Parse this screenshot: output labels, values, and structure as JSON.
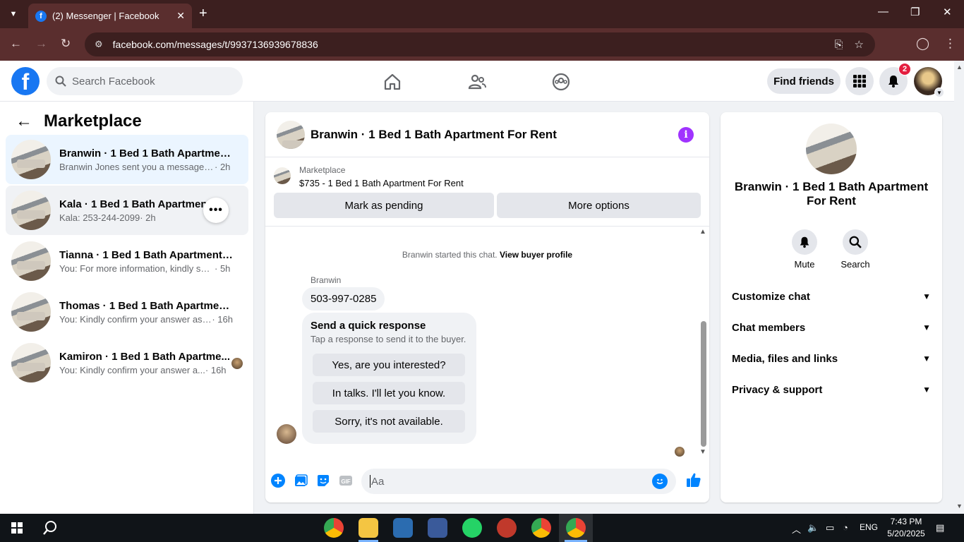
{
  "browser": {
    "tab_title": "(2) Messenger | Facebook",
    "tab_favicon": "f",
    "url": "facebook.com/messages/t/9937136939678836"
  },
  "fb": {
    "search_placeholder": "Search Facebook",
    "find_friends": "Find friends",
    "notif_count": "2"
  },
  "left": {
    "title": "Marketplace",
    "conversations": [
      {
        "name": "Branwin · 1 Bed 1 Bath Apartment ...",
        "snippet": "Branwin Jones sent you a message ab...",
        "time": "· 2h"
      },
      {
        "name": "Kala · 1 Bed 1 Bath Apartment F...",
        "snippet": "Kala: 253-244-2099",
        "time": "· 2h"
      },
      {
        "name": "Tianna · 1 Bed 1 Bath Apartment F...",
        "snippet": "You: For more information, kindly shar...",
        "time": "· 5h"
      },
      {
        "name": "Thomas · 1 Bed 1 Bath Apartment ...",
        "snippet": "You: Kindly confirm your answer as s...",
        "time": "· 16h"
      },
      {
        "name": "Kamiron · 1 Bed 1 Bath Apartme...",
        "snippet": "You: Kindly confirm your answer a...",
        "time": "· 16h"
      }
    ]
  },
  "chat": {
    "title": "Branwin · 1 Bed 1 Bath Apartment For Rent",
    "listing_source": "Marketplace",
    "listing_price": "$735 - 1 Bed 1 Bath Apartment For Rent",
    "mark_pending": "Mark as pending",
    "more_options": "More options",
    "system_note": "Branwin started this chat.",
    "view_buyer": "View buyer profile",
    "sender": "Branwin",
    "message": "503-997-0285",
    "quick_title": "Send a quick response",
    "quick_sub": "Tap a response to send it to the buyer.",
    "quick_replies": [
      "Yes, are you interested?",
      "In talks. I'll let you know.",
      "Sorry, it's not available."
    ],
    "input_placeholder": "Aa"
  },
  "right": {
    "name": "Branwin · 1 Bed 1 Bath Apartment For Rent",
    "mute": "Mute",
    "search": "Search",
    "sections": [
      "Customize chat",
      "Chat members",
      "Media, files and links",
      "Privacy & support"
    ]
  },
  "taskbar": {
    "lang": "ENG",
    "time": "7:43 PM",
    "date": "5/20/2025"
  },
  "colors": {
    "fb_blue": "#1877f2",
    "messenger_blue": "#0084ff",
    "info_purple": "#a033ff",
    "notif_red": "#e41e3f",
    "browser_frame": "#3c1f1f"
  }
}
